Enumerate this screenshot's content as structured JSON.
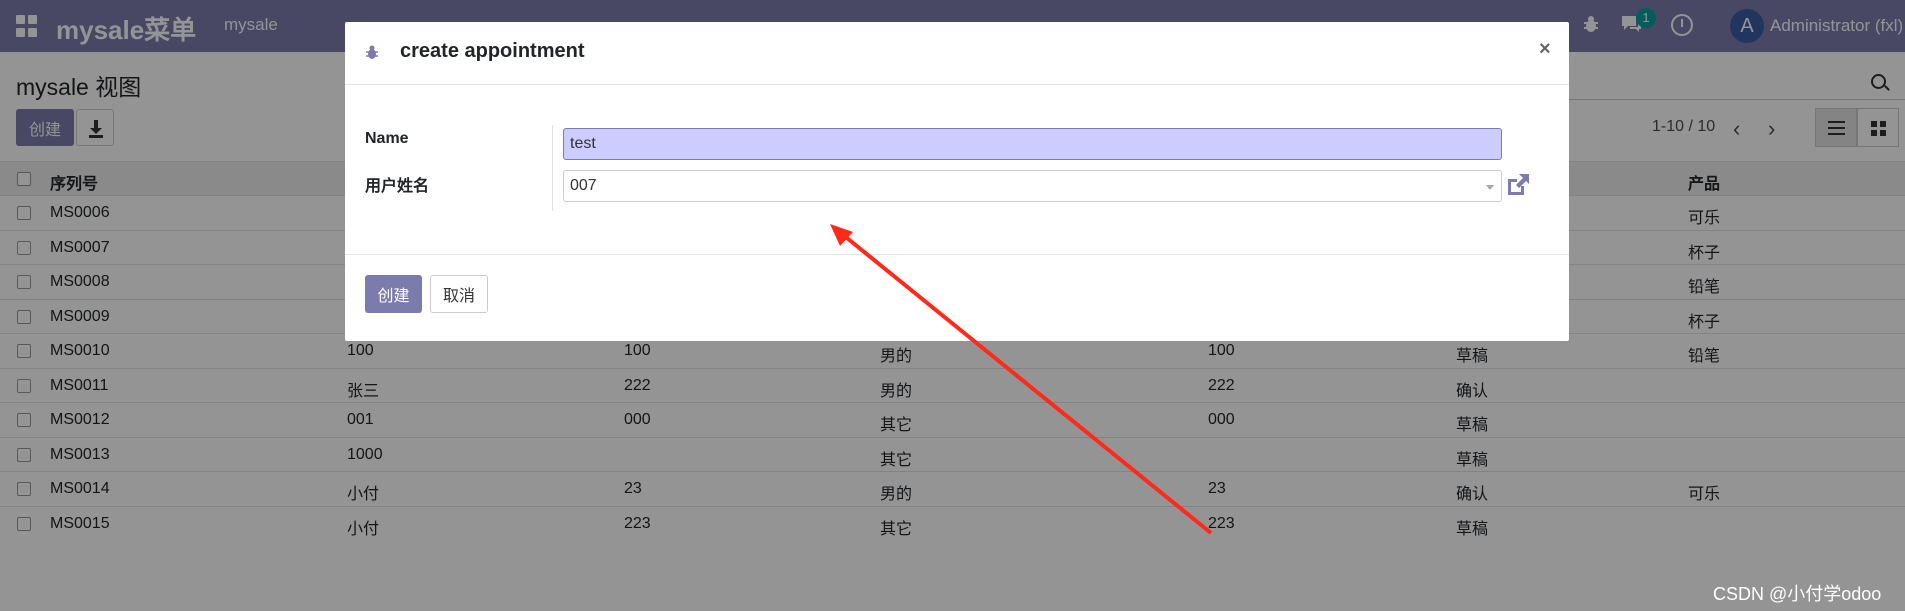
{
  "navbar": {
    "brand": "mysale菜单",
    "menu_item": "mysale",
    "chat_count": "1",
    "avatar_letter": "A",
    "user_name": "Administrator (fxl)"
  },
  "control_panel": {
    "title": "mysale 视图",
    "create_label": "创建",
    "pager_value": "1-10 / 10"
  },
  "table": {
    "headers": [
      "序列号",
      "",
      "",
      "",
      "",
      "",
      "产品"
    ],
    "rows": [
      [
        "MS0006",
        "",
        "",
        "",
        "",
        "",
        "可乐"
      ],
      [
        "MS0007",
        "",
        "",
        "",
        "",
        "",
        "杯子"
      ],
      [
        "MS0008",
        "",
        "",
        "",
        "",
        "",
        "铅笔"
      ],
      [
        "MS0009",
        "",
        "",
        "",
        "",
        "",
        "杯子"
      ],
      [
        "MS0010",
        "100",
        "100",
        "男的",
        "100",
        "草稿",
        "铅笔"
      ],
      [
        "MS0011",
        "张三",
        "222",
        "男的",
        "222",
        "确认",
        ""
      ],
      [
        "MS0012",
        "001",
        "000",
        "其它",
        "000",
        "草稿",
        ""
      ],
      [
        "MS0013",
        "1000",
        "",
        "其它",
        "",
        "草稿",
        ""
      ],
      [
        "MS0014",
        "小付",
        "23",
        "男的",
        "23",
        "确认",
        "可乐"
      ],
      [
        "MS0015",
        "小付",
        "223",
        "其它",
        "223",
        "草稿",
        ""
      ]
    ]
  },
  "modal": {
    "title": "create appointment",
    "close": "×",
    "name_label": "Name",
    "name_value": "test",
    "user_label": "用户姓名",
    "user_value": "007",
    "create_label": "创建",
    "cancel_label": "取消"
  },
  "annotation": {
    "arrow_color": "#ff2a1a"
  },
  "watermark": "CSDN @小付学odoo",
  "colors": {
    "primary": "#7c7bad",
    "focus_bg": "#ccccff",
    "badge": "#00a09d"
  }
}
